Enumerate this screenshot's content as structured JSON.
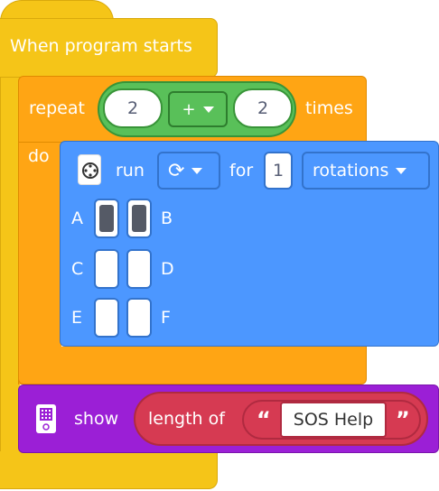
{
  "hat": {
    "label": "When program starts"
  },
  "repeat": {
    "label": "repeat",
    "do_label": "do",
    "times_label": "times",
    "left_value": "2",
    "operator": "+",
    "right_value": "2"
  },
  "motor_block": {
    "icon": "motor-icon",
    "run_label": "run",
    "direction_icon": "clockwise-icon",
    "for_label": "for",
    "amount": "1",
    "unit": "rotations",
    "ports": [
      {
        "label": "A",
        "selected": true
      },
      {
        "label": "B",
        "selected": true
      },
      {
        "label": "C",
        "selected": false
      },
      {
        "label": "D",
        "selected": false
      },
      {
        "label": "E",
        "selected": false
      },
      {
        "label": "F",
        "selected": false
      }
    ]
  },
  "show_block": {
    "icon": "hub-display-icon",
    "show_label": "show",
    "length_label": "length of",
    "open_quote": "“",
    "close_quote": "”",
    "text": "SOS Help"
  },
  "colors": {
    "events": "#f5c518",
    "control": "#ffa514",
    "operators": "#59c059",
    "motors": "#4c97ff",
    "display": "#9b1fd6",
    "string_op": "#d63a52"
  }
}
